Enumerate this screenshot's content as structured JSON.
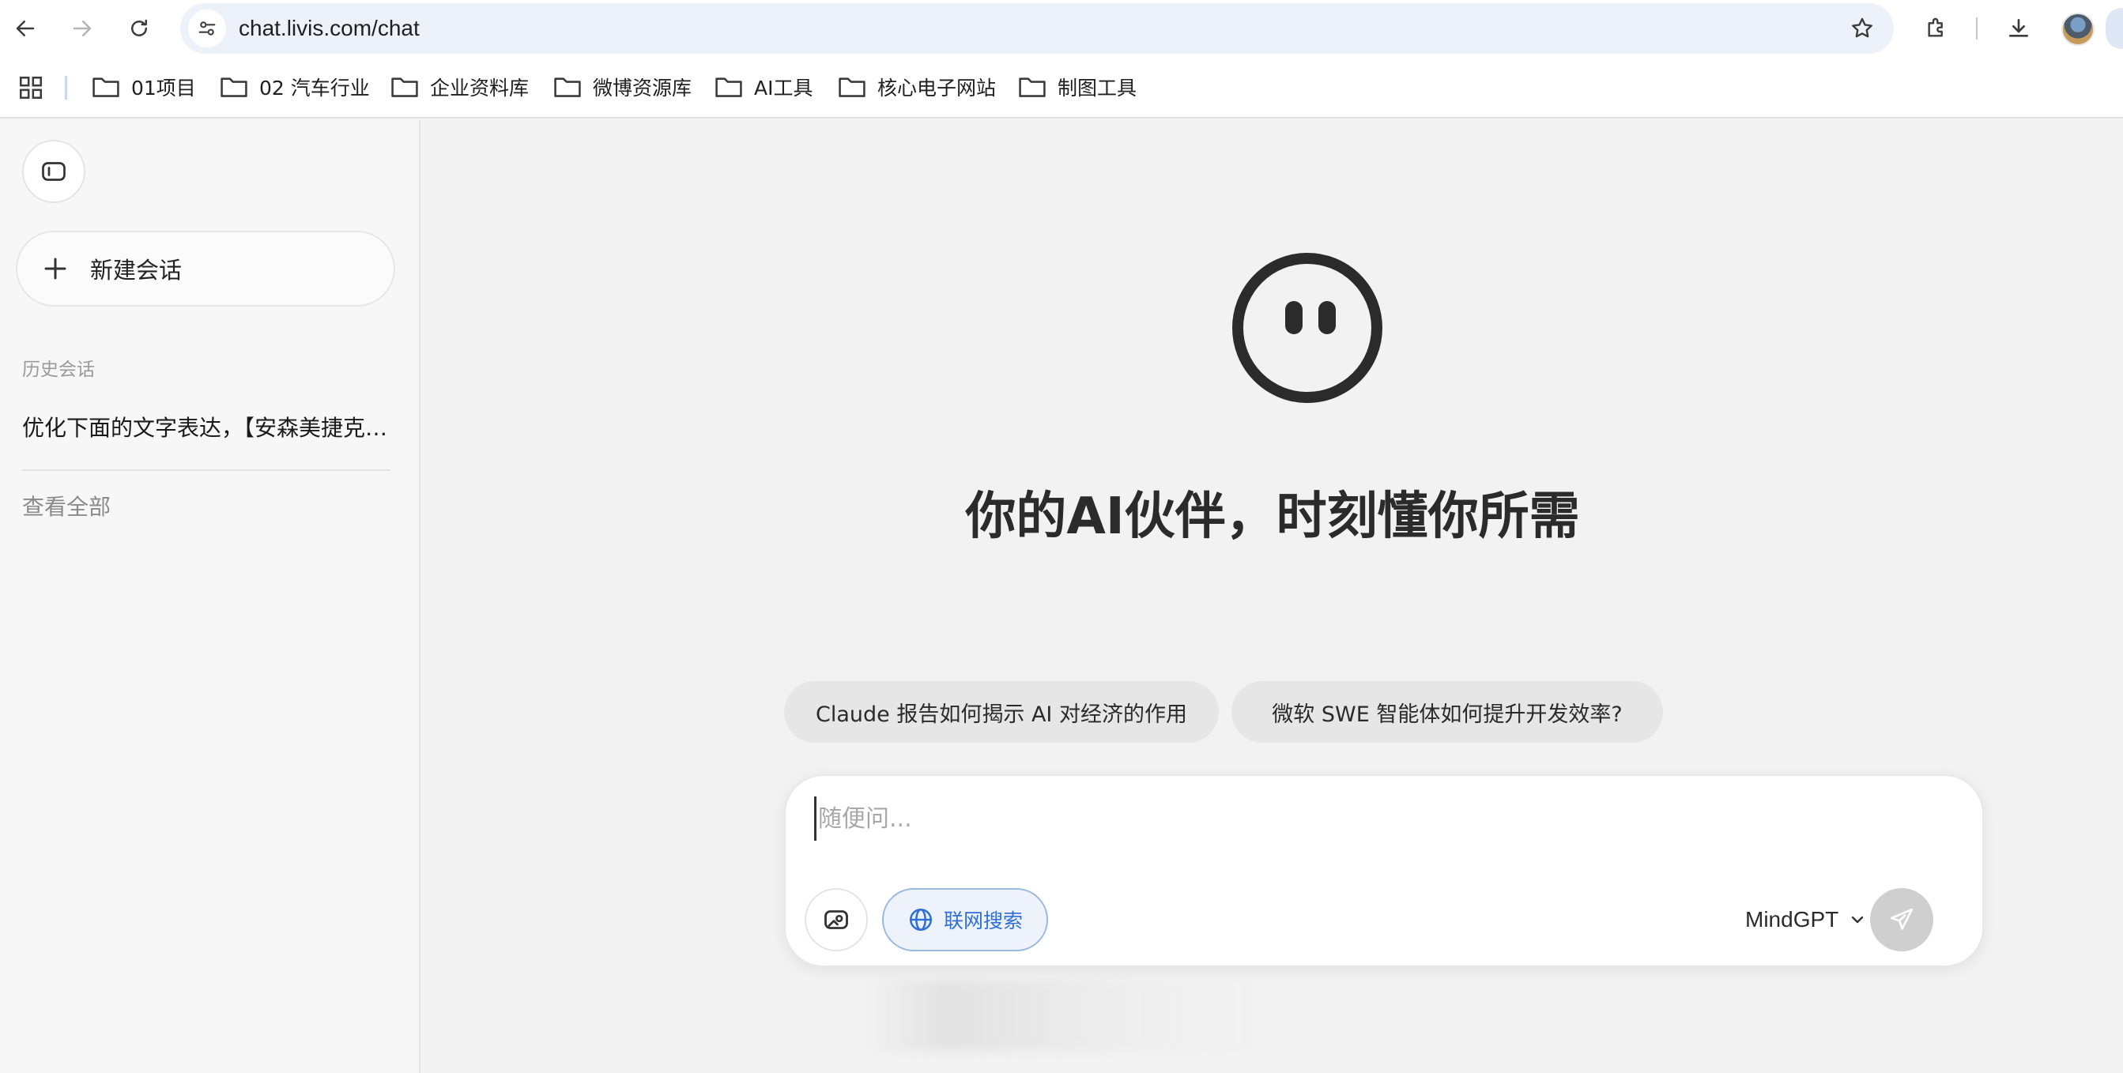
{
  "browser": {
    "url": "chat.livis.com/chat",
    "bookmarks": [
      {
        "label": "01项目"
      },
      {
        "label": "02 汽车行业"
      },
      {
        "label": "企业资料库"
      },
      {
        "label": "微博资源库"
      },
      {
        "label": "AI工具"
      },
      {
        "label": "核心电子网站"
      },
      {
        "label": "制图工具"
      }
    ]
  },
  "sidebar": {
    "new_chat_label": "新建会话",
    "history_heading": "历史会话",
    "history_items": [
      {
        "title": "优化下面的文字表达，【安森美捷克…"
      }
    ],
    "view_all_label": "查看全部"
  },
  "main": {
    "title": "你的AI伙伴，时刻懂你所需",
    "suggestions": [
      {
        "label": "Claude 报告如何揭示 AI 对经济的作用"
      },
      {
        "label": "微软 SWE 智能体如何提升开发效率?"
      }
    ],
    "composer": {
      "placeholder": "随便问...",
      "value": "",
      "web_search_label": "联网搜索",
      "model_label": "MindGPT"
    }
  },
  "colors": {
    "accent_blue": "#2f6fd6",
    "page_bg": "#f2f2f2",
    "sidebar_bg": "#f7f7f7",
    "send_disabled": "#cfcfcf"
  }
}
